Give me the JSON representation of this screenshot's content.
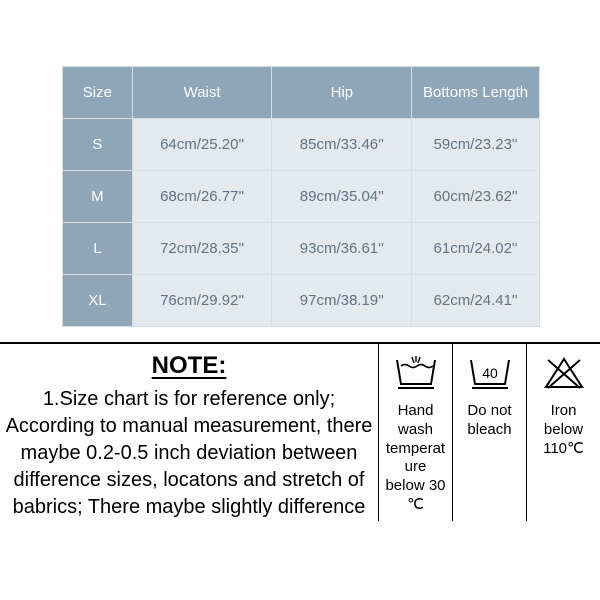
{
  "size_chart": {
    "headers": [
      "Size",
      "Waist",
      "Hip",
      "Bottoms Length"
    ],
    "rows": [
      {
        "size": "S",
        "waist": "64cm/25.20''",
        "hip": "85cm/33.46''",
        "length": "59cm/23.23''"
      },
      {
        "size": "M",
        "waist": "68cm/26.77''",
        "hip": "89cm/35.04''",
        "length": "60cm/23.62''"
      },
      {
        "size": "L",
        "waist": "72cm/28.35''",
        "hip": "93cm/36.61''",
        "length": "61cm/24.02''"
      },
      {
        "size": "XL",
        "waist": "76cm/29.92''",
        "hip": "97cm/38.19''",
        "length": "62cm/24.41''"
      }
    ]
  },
  "note": {
    "title": "NOTE:",
    "body": "1.Size chart is for reference only; According to manual measurement, there maybe 0.2-0.5 inch deviation between difference sizes, locatons and stretch of babrics; There maybe slightly difference"
  },
  "care": {
    "items": [
      {
        "icon": "handwash-icon",
        "label": "Hand wash temperat ure below 30 ℃"
      },
      {
        "icon": "bleach-icon",
        "label": "Do not bleach"
      },
      {
        "icon": "iron-icon",
        "label": "Iron below 110℃"
      }
    ]
  }
}
